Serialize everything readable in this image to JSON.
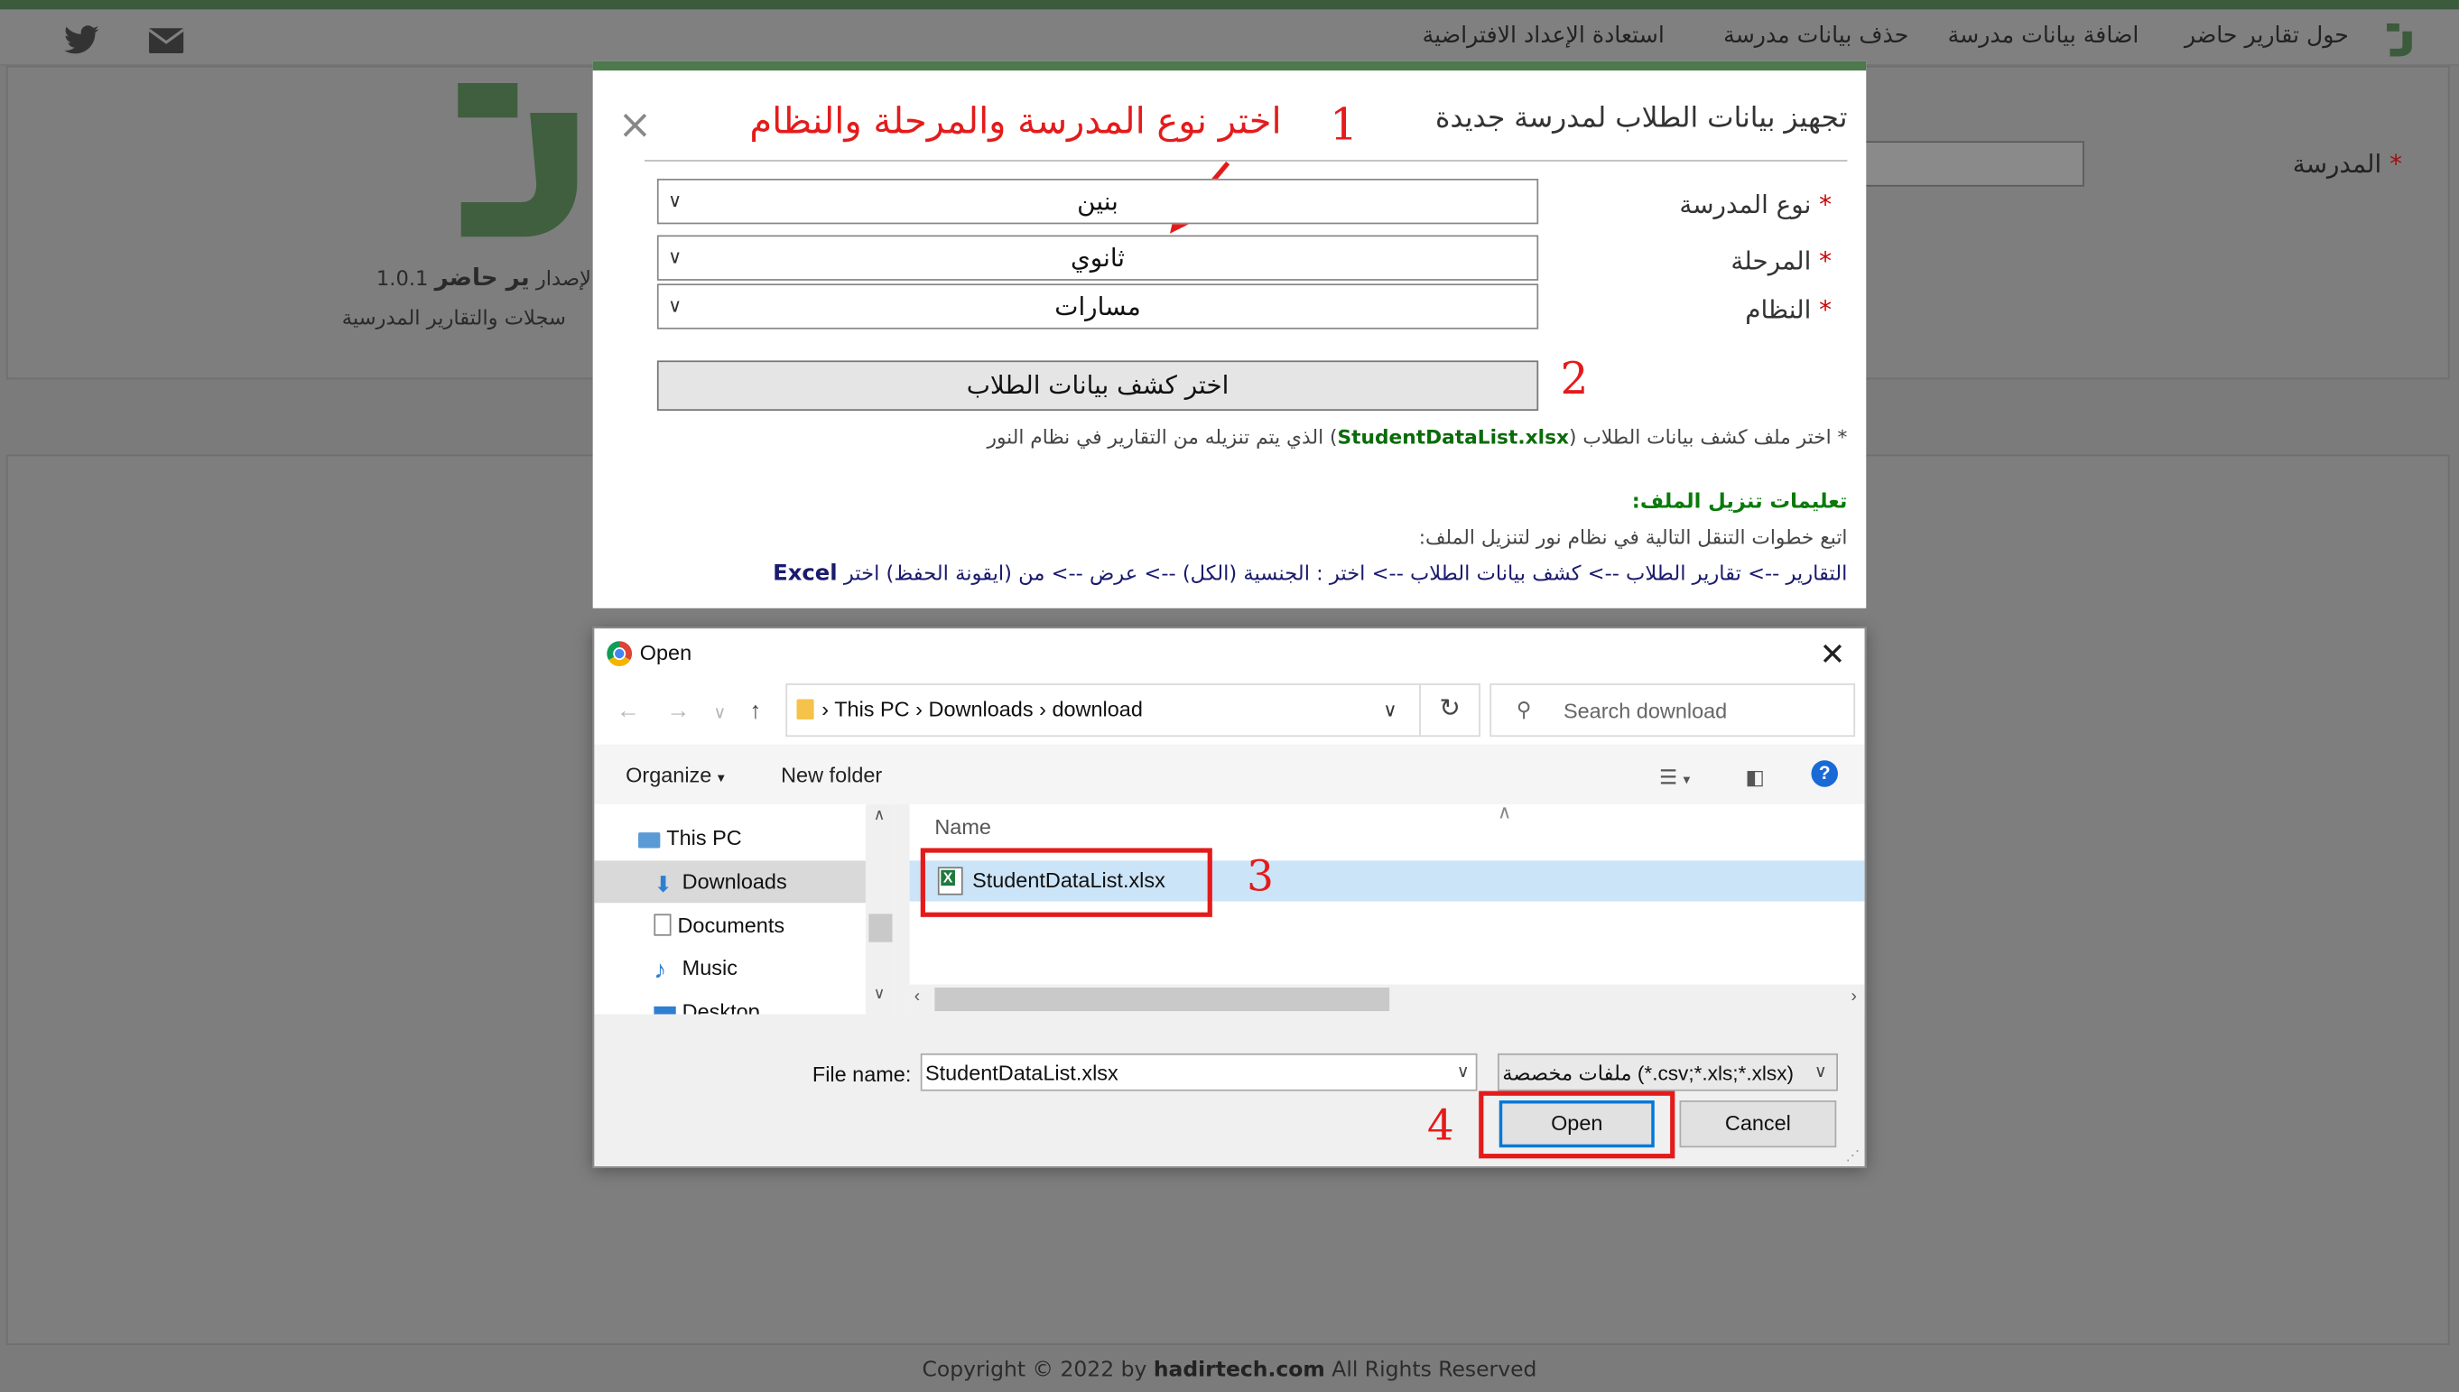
{
  "nav": {
    "about": "حول تقارير حاضر",
    "add_school": "اضافة بيانات مدرسة",
    "delete_school": "حذف بيانات مدرسة",
    "restore_defaults": "استعادة الإعداد الافتراضية"
  },
  "brand": {
    "name": "ير حاضر",
    "version_label": "الإصدار",
    "version": "1.0.1",
    "tagline": "سجلات والتقارير المدرسية"
  },
  "page": {
    "school_label": "المدرسة",
    "required_mark": "*"
  },
  "modal": {
    "title": "تجهيز بيانات الطلاب لمدرسة جديدة",
    "close": "×",
    "fields": {
      "school_type_label": "نوع المدرسة",
      "school_type_value": "بنين",
      "stage_label": "المرحلة",
      "stage_value": "ثانوي",
      "system_label": "النظام",
      "system_value": "مسارات",
      "required_mark": "*"
    },
    "choose_button": "اختر كشف بيانات الطلاب",
    "note_prefix": "* اختر ملف كشف بيانات الطلاب (",
    "note_file": "StudentDataList.xlsx",
    "note_suffix": ") الذي يتم تنزيله من التقارير في نظام النور",
    "instructions_title": "تعليمات تنزيل الملف:",
    "instructions_line1": "اتبع خطوات التنقل التالية في نظام نور لتنزيل الملف:",
    "instructions_line2": "التقارير --> تقارير الطلاب --> كشف بيانات الطلاب --> اختر : الجنسية (الكل) --> عرض --> من (ايقونة الحفظ) اختر",
    "instructions_excel": "Excel"
  },
  "annotations": {
    "step1_number": "1",
    "step1_text": "اختر نوع المدرسة والمرحلة والنظام",
    "step2": "2",
    "step3": "3",
    "step4": "4"
  },
  "dialog": {
    "title": "Open",
    "close": "✕",
    "breadcrumb": [
      "This PC",
      "Downloads",
      "download"
    ],
    "search_placeholder": "Search download",
    "organize": "Organize",
    "new_folder": "New folder",
    "help": "?",
    "tree": [
      "This PC",
      "Downloads",
      "Documents",
      "Music",
      "Desktop"
    ],
    "selected_tree_item": "Downloads",
    "column_name": "Name",
    "files": [
      "StudentDataList.xlsx"
    ],
    "file_name_label": "File name:",
    "file_name_value": "StudentDataList.xlsx",
    "file_type_value": "ملفات مخصصة (*.csv;*.xls;*.xlsx)",
    "open_button": "Open",
    "cancel_button": "Cancel"
  },
  "footer": {
    "prefix": "Copyright © 2022 by ",
    "site": "hadirtech.com",
    "suffix": " All Rights Reserved"
  },
  "colors": {
    "brand_green": "#3c5a3c",
    "annotation_red": "#e41b1b",
    "selection_blue": "#cce4f7",
    "accent_blue": "#0078d7"
  }
}
